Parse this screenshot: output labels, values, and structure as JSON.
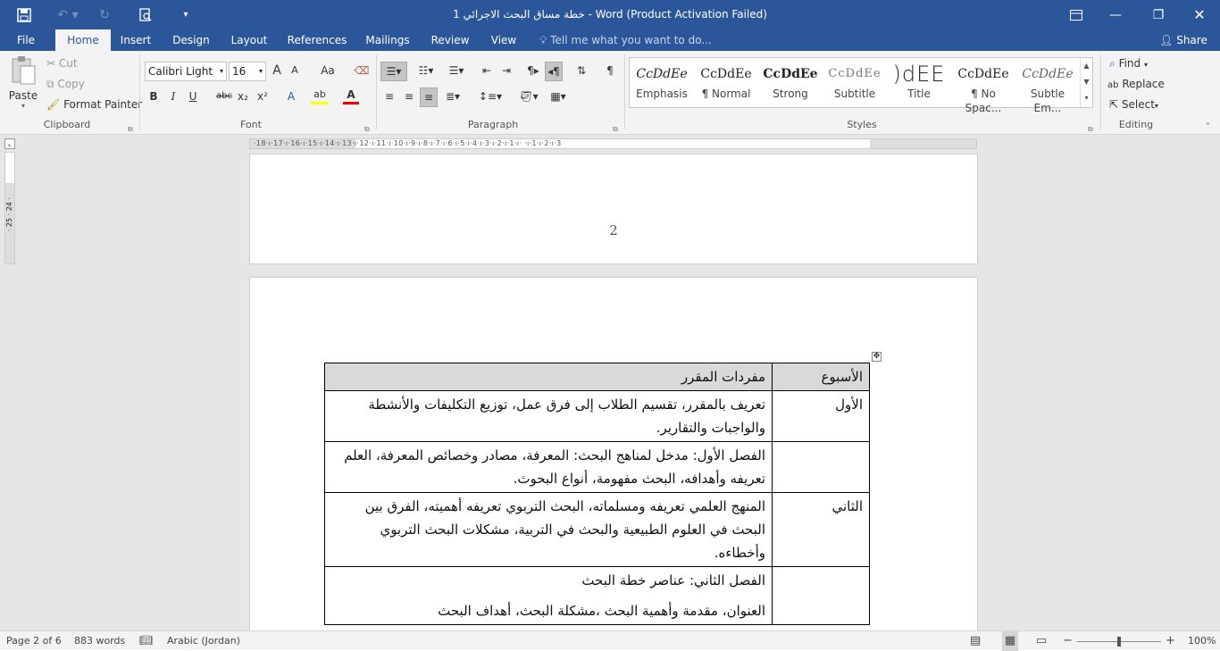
{
  "window": {
    "title": "خطة مساق البحث الاجرائي 1 - Word (Product Activation Failed)"
  },
  "quick_access": {
    "save_icon": "save-icon",
    "undo_icon": "undo-icon",
    "redo_icon": "redo-icon",
    "print_preview_icon": "print-preview-icon",
    "customize_icon": "chevron-down-icon"
  },
  "tabs": [
    "File",
    "Home",
    "Insert",
    "Design",
    "Layout",
    "References",
    "Mailings",
    "Review",
    "View"
  ],
  "tell_me": "Tell me what you want to do...",
  "share": "Share",
  "clipboard": {
    "paste": "Paste",
    "cut": "Cut",
    "copy": "Copy",
    "format_painter": "Format Painter",
    "label": "Clipboard"
  },
  "font": {
    "name": "Calibri Light",
    "size": "16",
    "label": "Font",
    "grow": "A",
    "shrink": "A",
    "case": "Aa",
    "bold": "B",
    "italic": "I",
    "underline": "U",
    "strike": "abc",
    "sub": "x₂",
    "sup": "x²",
    "effects": "A",
    "highlight": "ab",
    "color": "A"
  },
  "paragraph": {
    "label": "Paragraph",
    "pilcrow": "¶"
  },
  "styles": {
    "label": "Styles",
    "items": [
      {
        "sample": "CcDdEe",
        "name": "Emphasis"
      },
      {
        "sample": "CcDdEe",
        "name": "¶ Normal"
      },
      {
        "sample": "CcDdEe",
        "name": "Strong"
      },
      {
        "sample": "CcDdEe",
        "name": "Subtitle"
      },
      {
        "sample": ")dEE",
        "name": "Title"
      },
      {
        "sample": "CcDdEe",
        "name": "¶ No Spac..."
      },
      {
        "sample": "CcDdEe",
        "name": "Subtle Em..."
      }
    ]
  },
  "editing": {
    "find": "Find",
    "replace": "Replace",
    "select": "Select",
    "label": "Editing"
  },
  "ruler": {
    "ticks": "·18·ı·17·ı·16·ı·15·ı·14·ı·13·ı·12·ı·11·ı·10·ı·9·ı·8·ı·7·ı·6·ı·5·ı·4·ı·3·ı·2·ı·1·ı·  ·ı·1·ı·2·ı·3",
    "vticks": "· 25 · 24 ·"
  },
  "document": {
    "page_number": "2",
    "table": {
      "headers": {
        "week": "الأسبوع",
        "content": "مفردات المقرر"
      },
      "rows": [
        {
          "week": "الأول",
          "content": "تعريف بالمقرر، تقسيم الطلاب إلى فرق عمل، توزيع التكليفات والأنشطة والواجبات والتقارير."
        },
        {
          "week": "",
          "content": "الفصل الأول: مدخل لمناهج البحث: المعرفة، مصادر وخصائص المعرفة، العلم تعريفه وأهدافه، البحث مفهومة، أنواع البحوث."
        },
        {
          "week": "الثاني",
          "content": "المنهج العلمي تعريفه ومسلماته، البحث التربوي تعريفه أهميته، الفرق بين البحث في العلوم الطبيعية والبحث في التربية، مشكلات البحث التربوي وأخطاءه."
        },
        {
          "week": "",
          "content": "الفصل الثاني: عناصر خطة البحث",
          "content2": "العنوان، مقدمة وأهمية البحث ،مشكلة البحث، أهداف البحث"
        }
      ]
    }
  },
  "status": {
    "page": "Page 2 of 6",
    "words": "883 words",
    "language": "Arabic (Jordan)",
    "zoom": "100%",
    "zoom_level": 0.5
  }
}
